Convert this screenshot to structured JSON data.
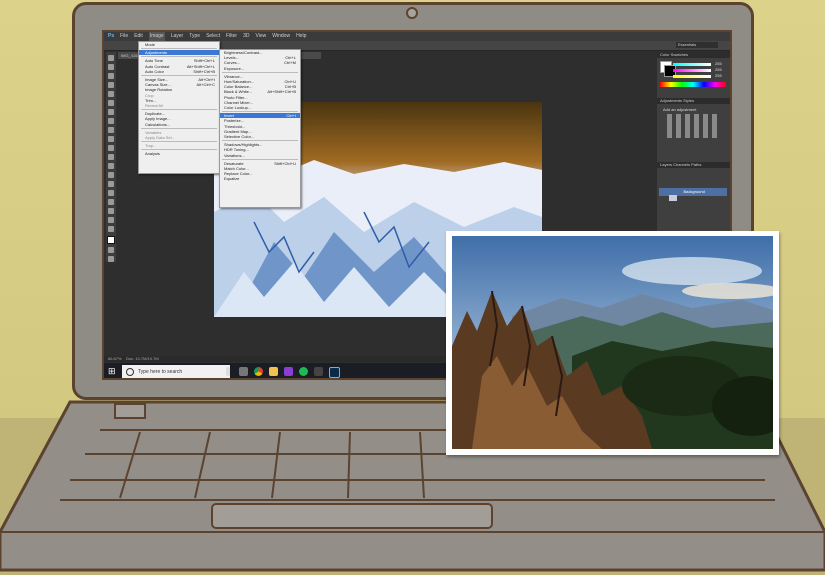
{
  "ps": {
    "logo": "Ps",
    "menu": [
      "File",
      "Edit",
      "Image",
      "Layer",
      "Type",
      "Select",
      "Filter",
      "3D",
      "View",
      "Window",
      "Help"
    ],
    "workspace": "Essentials",
    "doc_tab": "IMG_4154.jpg @ 66.7% (Background, RGB/8)"
  },
  "image_menu": {
    "items": [
      {
        "label": "Mode",
        "sc": ""
      },
      {
        "label": "Adjustments",
        "sc": "",
        "hl": true
      },
      {
        "label": "Auto Tone",
        "sc": "Shift+Ctrl+L"
      },
      {
        "label": "Auto Contrast",
        "sc": "Alt+Shift+Ctrl+L"
      },
      {
        "label": "Auto Color",
        "sc": "Shift+Ctrl+B"
      },
      {
        "label": "Image Size...",
        "sc": "Alt+Ctrl+I"
      },
      {
        "label": "Canvas Size...",
        "sc": "Alt+Ctrl+C"
      },
      {
        "label": "Image Rotation",
        "sc": ""
      },
      {
        "label": "Crop",
        "sc": ""
      },
      {
        "label": "Trim...",
        "sc": ""
      },
      {
        "label": "Reveal All",
        "sc": ""
      },
      {
        "label": "Duplicate...",
        "sc": ""
      },
      {
        "label": "Apply Image...",
        "sc": ""
      },
      {
        "label": "Calculations...",
        "sc": ""
      },
      {
        "label": "Variables",
        "sc": ""
      },
      {
        "label": "Apply Data Set...",
        "sc": ""
      },
      {
        "label": "Trap...",
        "sc": ""
      },
      {
        "label": "Analysis",
        "sc": ""
      }
    ]
  },
  "adjust_menu": {
    "items": [
      {
        "label": "Brightness/Contrast...",
        "sc": ""
      },
      {
        "label": "Levels...",
        "sc": "Ctrl+L"
      },
      {
        "label": "Curves...",
        "sc": "Ctrl+M"
      },
      {
        "label": "Exposure...",
        "sc": ""
      },
      {
        "label": "Vibrance...",
        "sc": ""
      },
      {
        "label": "Hue/Saturation...",
        "sc": "Ctrl+U"
      },
      {
        "label": "Color Balance...",
        "sc": "Ctrl+B"
      },
      {
        "label": "Black & White...",
        "sc": "Alt+Shift+Ctrl+B"
      },
      {
        "label": "Photo Filter...",
        "sc": ""
      },
      {
        "label": "Channel Mixer...",
        "sc": ""
      },
      {
        "label": "Color Lookup...",
        "sc": ""
      },
      {
        "label": "Invert",
        "sc": "Ctrl+I",
        "hl": true
      },
      {
        "label": "Posterize...",
        "sc": ""
      },
      {
        "label": "Threshold...",
        "sc": ""
      },
      {
        "label": "Gradient Map...",
        "sc": ""
      },
      {
        "label": "Selective Color...",
        "sc": ""
      },
      {
        "label": "Shadows/Highlights...",
        "sc": ""
      },
      {
        "label": "HDR Toning...",
        "sc": ""
      },
      {
        "label": "Variations...",
        "sc": ""
      },
      {
        "label": "Desaturate",
        "sc": "Shift+Ctrl+U"
      },
      {
        "label": "Match Color...",
        "sc": ""
      },
      {
        "label": "Replace Color...",
        "sc": ""
      },
      {
        "label": "Equalize",
        "sc": ""
      }
    ]
  },
  "panels": {
    "color_tabs": "Color   Swatches",
    "adj_tabs": "Adjustments   Styles",
    "adj_title": "Add an adjustment",
    "layers_tabs": "Layers   Channels   Paths",
    "layer_name": "Background",
    "slider_values": [
      "255",
      "255",
      "255"
    ]
  },
  "status": {
    "zoom": "66.67%",
    "doc": "Doc: 10.7M/10.7M"
  },
  "taskbar": {
    "search_placeholder": "Type here to search"
  },
  "colors": {
    "highlight": "#3b77d3",
    "ps_dark": "#2e2e2e",
    "outline": "#5b4330"
  }
}
